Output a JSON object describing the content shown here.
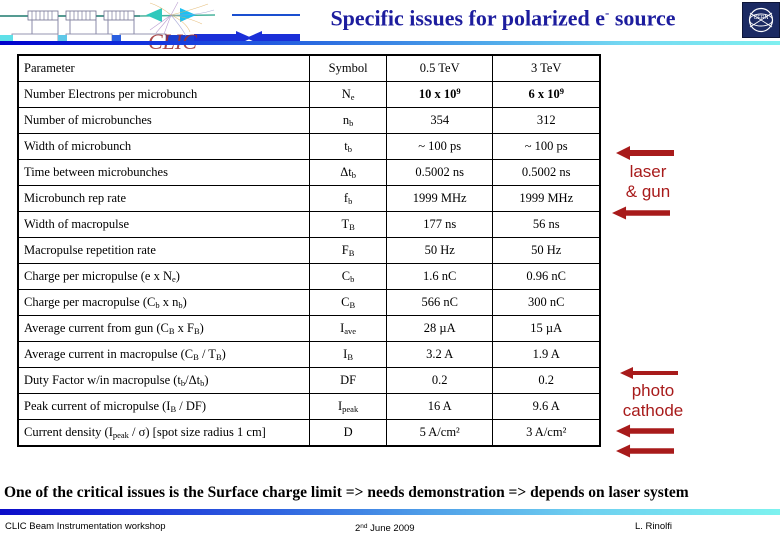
{
  "header": {
    "title_main": "Specific issues for polarized e",
    "title_sup": "-",
    "title_tail": " source",
    "logo_text": "CERN",
    "clic_wordmark": "CLIC"
  },
  "table": {
    "columns": [
      "Parameter",
      "Symbol",
      "0.5 TeV",
      "3 TeV"
    ],
    "rows": [
      {
        "parameter": "Number Electrons per microbunch",
        "symbol_base": "N",
        "symbol_sub": "e",
        "v1": "10 x 10",
        "v1_sup": "9",
        "v2": "6 x 10",
        "v2_sup": "9",
        "style": "bold"
      },
      {
        "parameter": "Number of microbunches",
        "symbol_base": "n",
        "symbol_sub": "b",
        "v1": "354",
        "v2": "312",
        "style": "normal"
      },
      {
        "parameter": "Width of microbunch",
        "symbol_base": "t",
        "symbol_sub": "b",
        "v1": "~ 100 ps",
        "v2": "~ 100 ps",
        "style": "red"
      },
      {
        "parameter": "Time between microbunches",
        "symbol_base": "Δt",
        "symbol_sub": "b",
        "v1": "0.5002 ns",
        "v2": "0.5002 ns",
        "style": "normal"
      },
      {
        "parameter": "Microbunch rep rate",
        "symbol_base": "f",
        "symbol_sub": "b",
        "v1": "1999 MHz",
        "v2": "1999 MHz",
        "style": "red"
      },
      {
        "parameter": "Width of macropulse",
        "symbol_base": "T",
        "symbol_sub": "B",
        "v1": "177 ns",
        "v2": "56 ns",
        "style": "normal"
      },
      {
        "parameter": "Macropulse repetition rate",
        "symbol_base": "F",
        "symbol_sub": "B",
        "v1": "50 Hz",
        "v2": "50 Hz",
        "style": "normal"
      },
      {
        "parameter": "Charge per micropulse (e x Ne)",
        "symbol_base": "C",
        "symbol_sub": "b",
        "v1": "1.6 nC",
        "v2": "0.96 nC",
        "style": "normal"
      },
      {
        "parameter": "Charge per macropulse (Cb x nb)",
        "symbol_base": "C",
        "symbol_sub": "B",
        "v1": "566 nC",
        "v2": "300 nC",
        "style": "normal"
      },
      {
        "parameter": "Average current from gun (CB x FB)",
        "symbol_base": "I",
        "symbol_sub": "ave",
        "v1": "28 µA",
        "v2": "15 µA",
        "style": "normal"
      },
      {
        "parameter": "Average current in macropulse (CB / TB)",
        "symbol_base": "I",
        "symbol_sub": "B",
        "v1": "3.2 A",
        "v2": "1.9 A",
        "style": "red"
      },
      {
        "parameter": "Duty Factor w/in macropulse (tb/Δtb)",
        "symbol_base": "DF",
        "symbol_sub": "",
        "v1": "0.2",
        "v2": "0.2",
        "style": "normal"
      },
      {
        "parameter": "Peak current of micropulse (IB / DF)",
        "symbol_base": "I",
        "symbol_sub": "peak",
        "v1": "16 A",
        "v2": "9.6 A",
        "style": "red"
      },
      {
        "parameter": "Current density (Ipeak / σ) [spot size radius 1 cm]",
        "symbol_base": "D",
        "symbol_sub": "",
        "v1": "5 A/cm²",
        "v2": "3 A/cm²",
        "style": "red"
      }
    ]
  },
  "annotations": {
    "laser_gun_line1": "laser",
    "laser_gun_line2": "& gun",
    "photocathode_line1": "photo",
    "photocathode_line2": "cathode",
    "arrow_color": "#a81b1b"
  },
  "statement": "One of the critical issues is the Surface charge limit => needs demonstration => depends on laser system",
  "footer": {
    "left": "CLIC Beam Instrumentation workshop",
    "mid_num": "2",
    "mid_sup": "nd",
    "mid_rest": " June 2009",
    "right": "L. Rinolfi"
  },
  "colors": {
    "title": "#1d1d9e",
    "accent_red": "#a02020",
    "annotation_red": "#a81b1b",
    "logo_bg": "#1b2a63"
  }
}
